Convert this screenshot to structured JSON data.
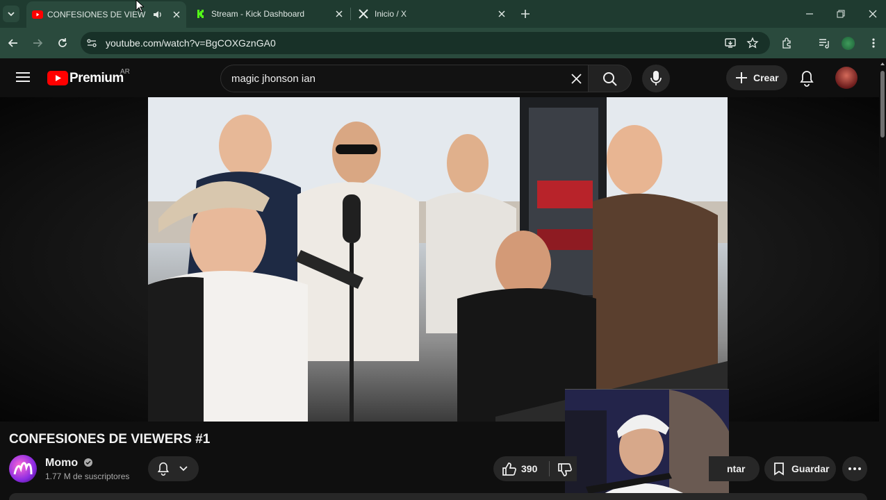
{
  "browser": {
    "tabs": [
      {
        "label": "CONFESIONES DE VIEWERS #",
        "active": true,
        "icon": "youtube-icon"
      },
      {
        "label": "Stream - Kick Dashboard",
        "active": false,
        "icon": "kick-icon"
      },
      {
        "label": "Inicio / X",
        "active": false,
        "icon": "x-icon"
      }
    ],
    "url": "youtube.com/watch?v=BgCOXGznGA0",
    "accent": "#2a4a3d"
  },
  "youtube": {
    "logo_text": "Premium",
    "logo_badge": "AR",
    "search_value": "magic jhonson ian",
    "create_label": "Crear",
    "brand_red": "#ff0000"
  },
  "video": {
    "title": "CONFESIONES DE VIEWERS #1",
    "channel": {
      "name": "Momo",
      "verified": true,
      "subscribers": "1.77 M de suscriptores"
    },
    "likes": "390",
    "partial_label": "ntar",
    "save_label": "Guardar"
  }
}
